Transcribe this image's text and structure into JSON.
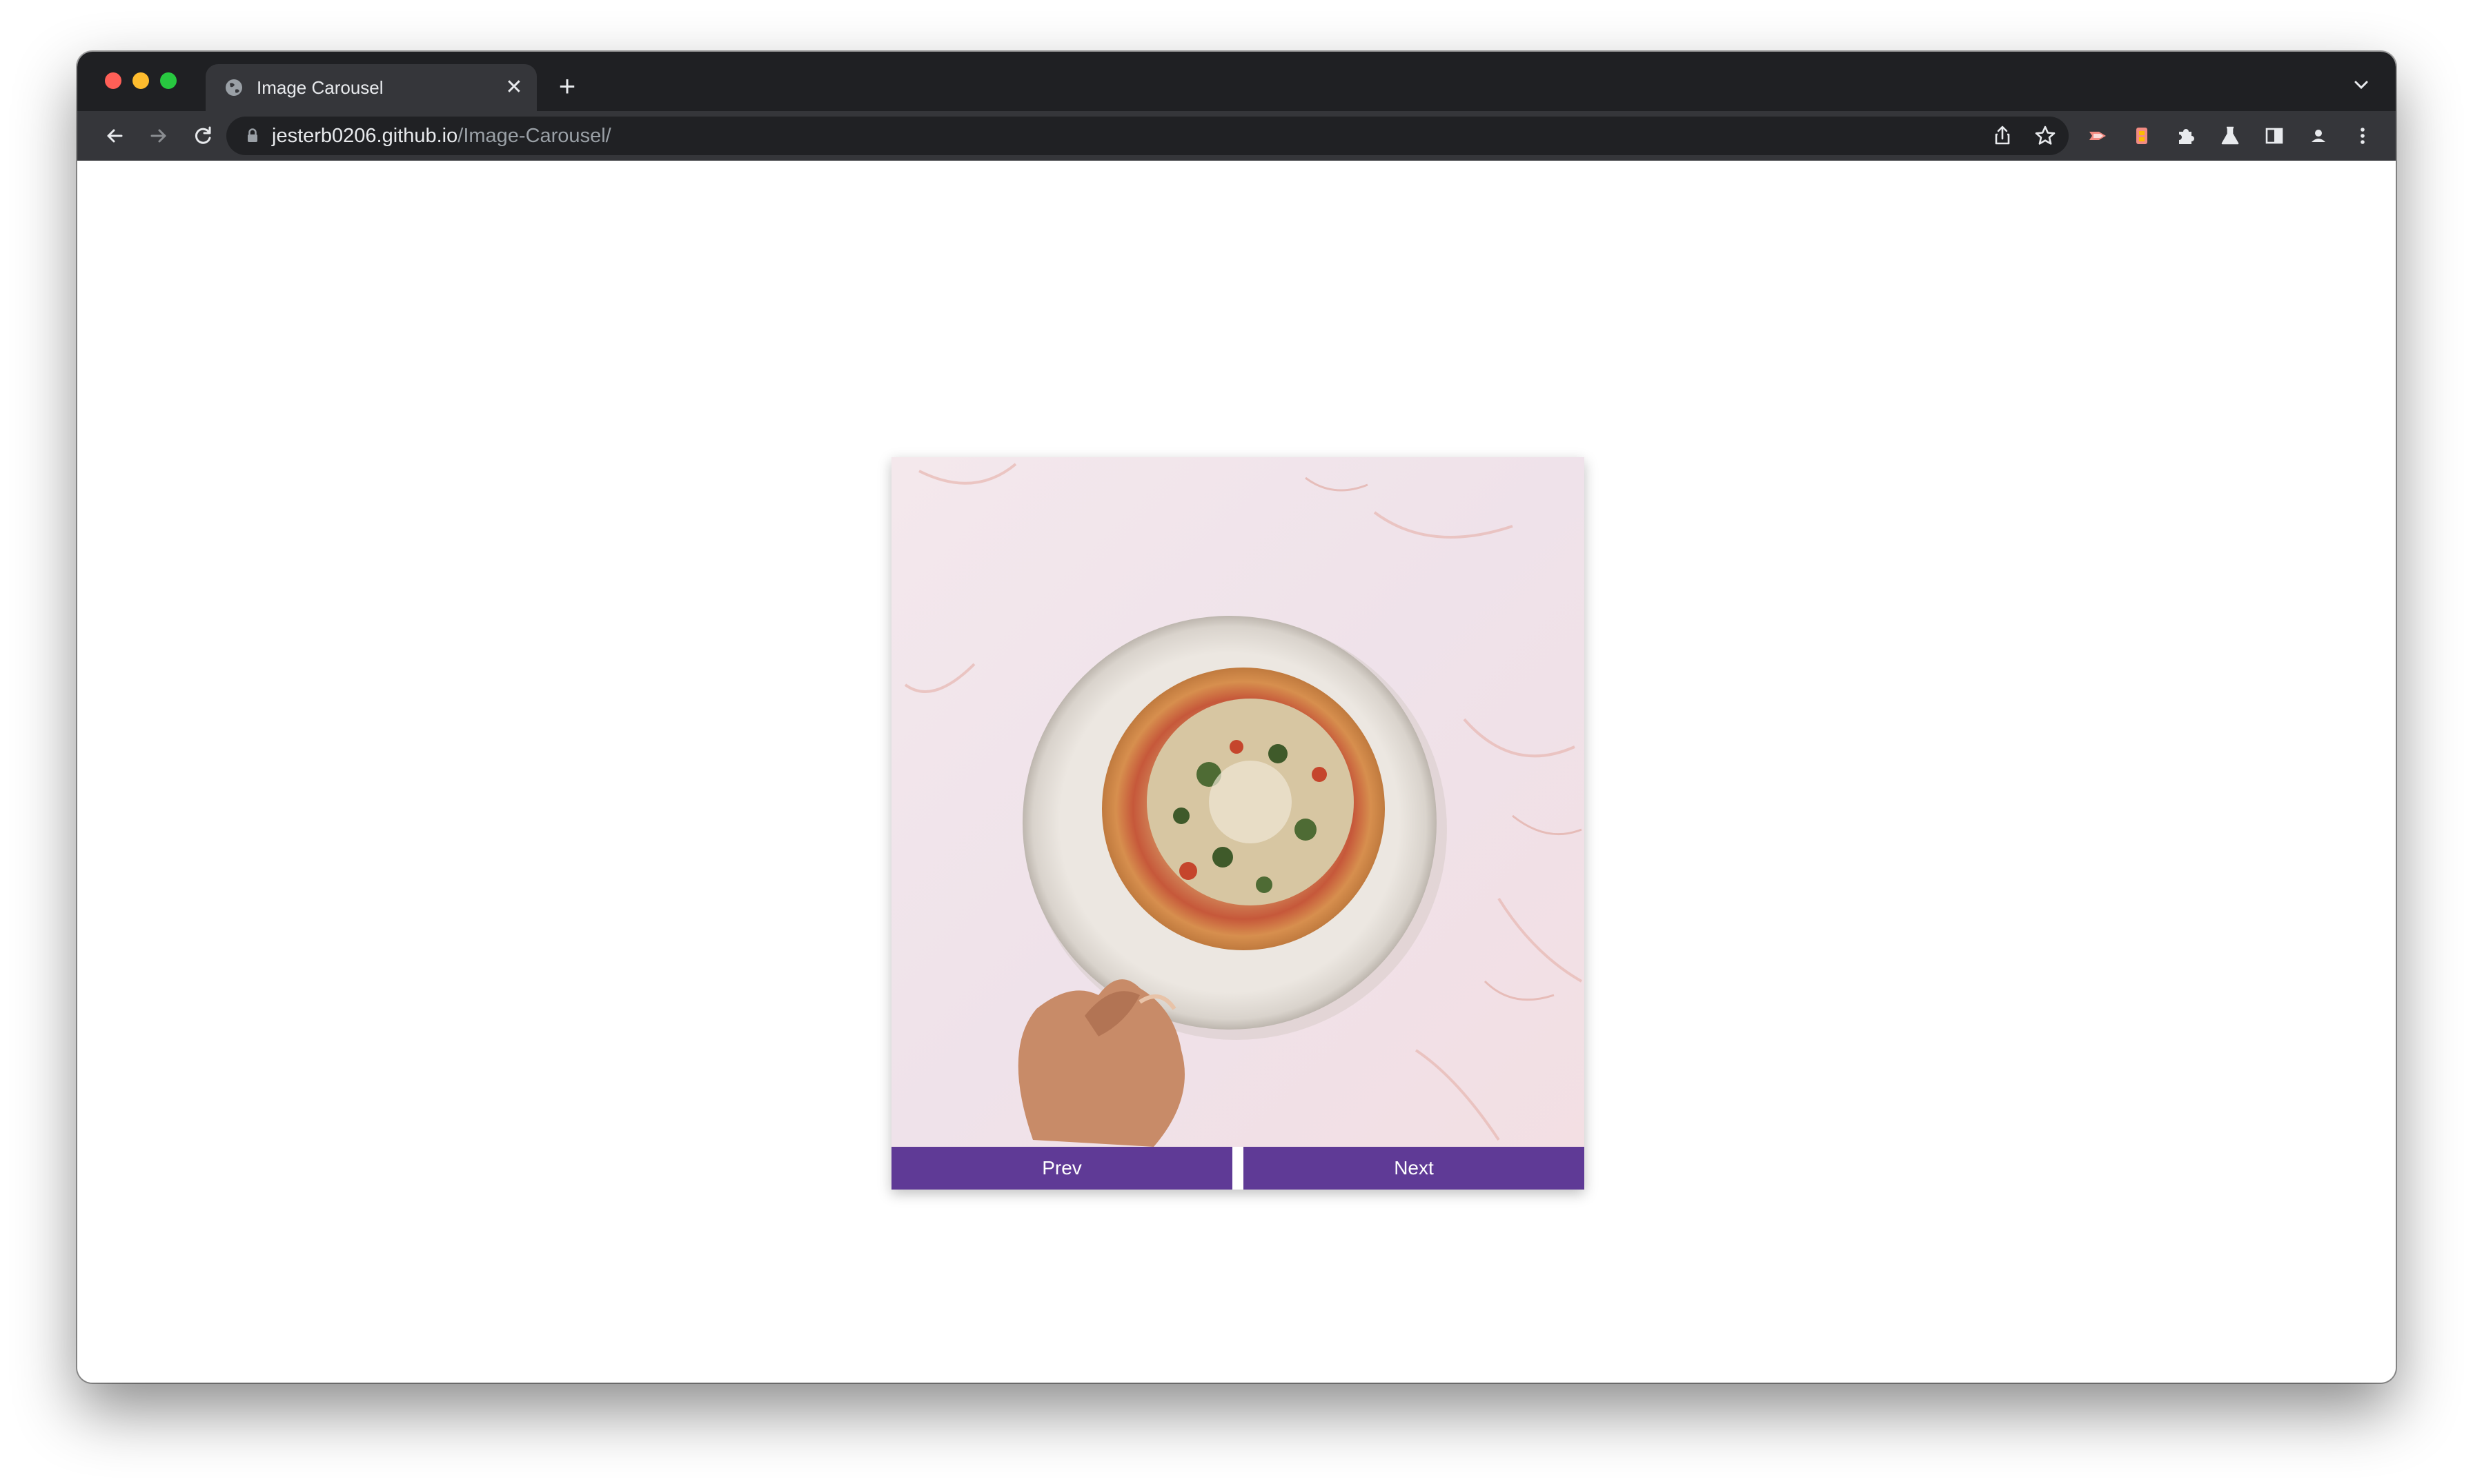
{
  "browser": {
    "tab": {
      "title": "Image Carousel",
      "favicon": "globe-icon",
      "close_glyph": "✕"
    },
    "new_tab_glyph": "+",
    "address_bar": {
      "host": "jesterb0206.github.io",
      "path": "/Image-Carousel/"
    },
    "toolbar_icons": [
      "back-arrow-icon",
      "forward-arrow-icon",
      "reload-icon",
      "share-icon",
      "bookmark-star-icon",
      "extension-icon",
      "extension-icon",
      "puzzle-icon",
      "labs-flask-icon",
      "side-panel-icon",
      "profile-icon",
      "more-menu-icon"
    ]
  },
  "carousel": {
    "slide_alt": "pizza",
    "prev_label": "Prev",
    "next_label": "Next"
  },
  "colors": {
    "accent": "#5f3a96",
    "chrome_dark": "#1f2023",
    "chrome_toolbar": "#35363a"
  }
}
